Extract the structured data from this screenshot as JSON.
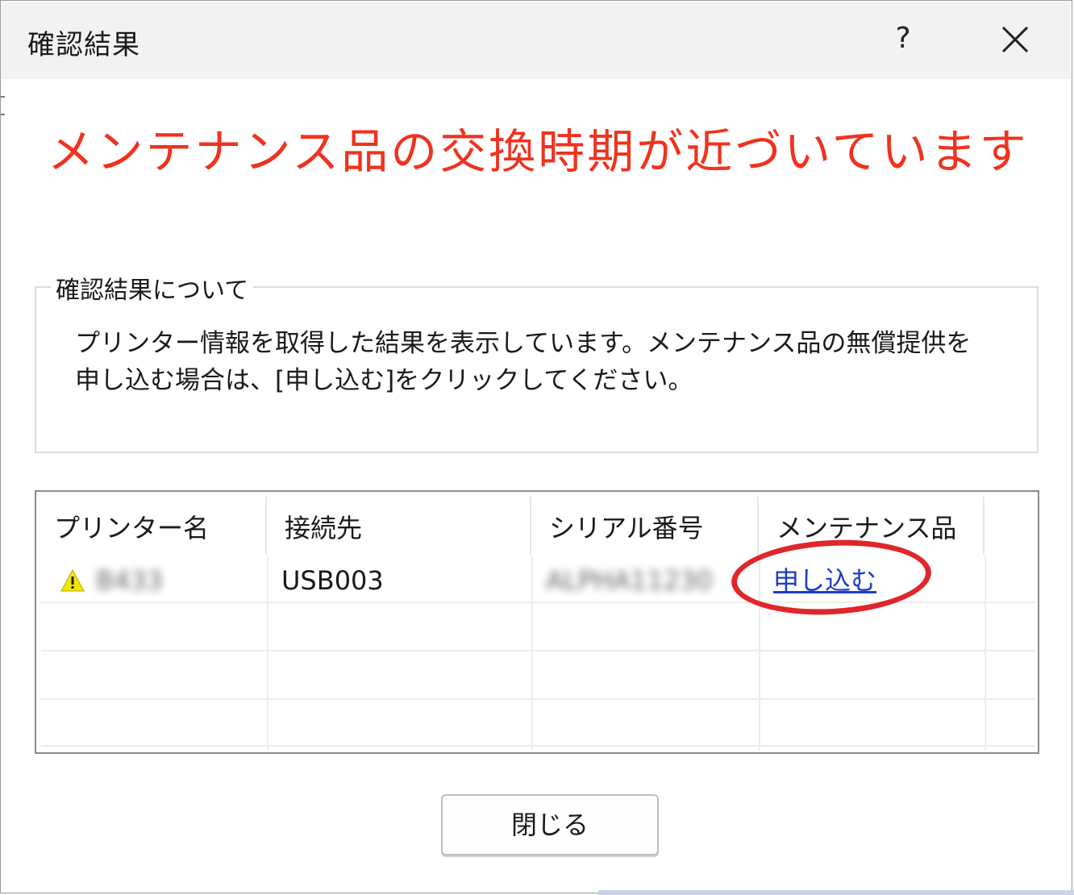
{
  "window": {
    "title": "確認結果",
    "help_label": "?",
    "close_icon": "close-icon"
  },
  "headline": "メンテナンス品の交換時期が近づいています",
  "info_group": {
    "legend": "確認結果について",
    "line1": "プリンター情報を取得した結果を表示しています。メンテナンス品の無償提供を",
    "line2": "申し込む場合は、[申し込む]をクリックしてください。"
  },
  "table": {
    "columns": [
      "プリンター名",
      "接続先",
      "シリアル番号",
      "メンテナンス品"
    ],
    "rows": [
      {
        "status_icon": "warning-icon",
        "printer_name": "B433",
        "connection": "USB003",
        "serial": "ALPHA11230",
        "maintenance_link": "申し込む"
      }
    ]
  },
  "buttons": {
    "close_label": "閉じる"
  },
  "colors": {
    "headline": "#f0321e",
    "link": "#1f3cc8",
    "highlight_circle": "#e0262a",
    "warning": "#f2e600"
  }
}
